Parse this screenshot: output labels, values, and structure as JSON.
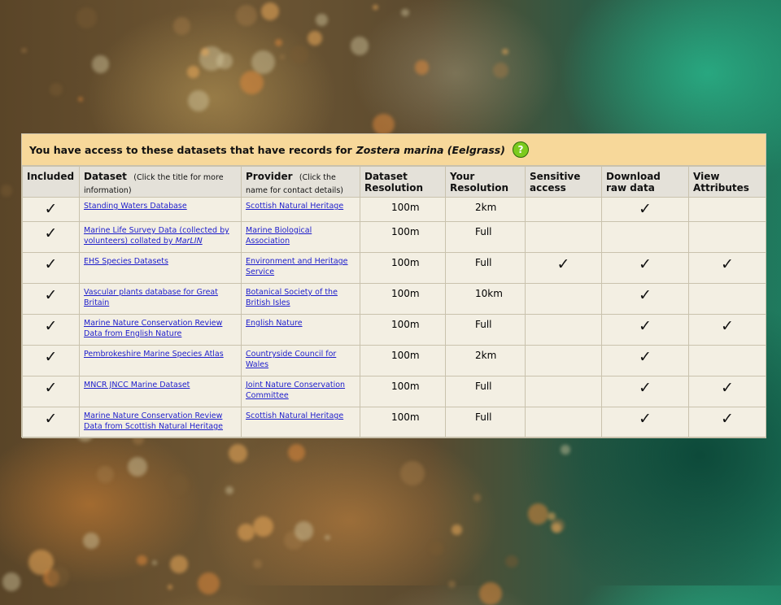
{
  "panel": {
    "header_prefix": "You have access to these datasets that have records for",
    "species": "Zostera marina (Eelgrass)",
    "help_symbol": "?"
  },
  "columns": {
    "included": "Included",
    "dataset": "Dataset",
    "dataset_hint": "(Click the title for more information)",
    "provider": "Provider",
    "provider_hint": "(Click the name for contact details)",
    "dataset_resolution_1": "Dataset",
    "dataset_resolution_2": "Resolution",
    "your_resolution_1": "Your",
    "your_resolution_2": "Resolution",
    "sensitive_1": "Sensitive",
    "sensitive_2": "access",
    "download_1": "Download",
    "download_2": "raw data",
    "view_1": "View",
    "view_2": "Attributes"
  },
  "check_symbol": "✓",
  "rows": [
    {
      "dataset": "Standing Waters Database",
      "dataset_marlin": "",
      "provider": "Scottish Natural Heritage",
      "dataset_resolution": "100m",
      "your_resolution": "2km",
      "included": true,
      "sensitive": false,
      "download": true,
      "view": false
    },
    {
      "dataset": "Marine Life Survey Data (collected by volunteers) collated by ",
      "dataset_marlin": "MarLIN",
      "provider": "Marine Biological Association",
      "dataset_resolution": "100m",
      "your_resolution": "Full",
      "included": true,
      "sensitive": false,
      "download": false,
      "view": false
    },
    {
      "dataset": "EHS Species Datasets",
      "dataset_marlin": "",
      "provider": "Environment and Heritage Service",
      "dataset_resolution": "100m",
      "your_resolution": "Full",
      "included": true,
      "sensitive": true,
      "download": true,
      "view": true
    },
    {
      "dataset": "Vascular plants database for Great Britain",
      "dataset_marlin": "",
      "provider": "Botanical Society of the British Isles",
      "dataset_resolution": "100m",
      "your_resolution": "10km",
      "included": true,
      "sensitive": false,
      "download": true,
      "view": false
    },
    {
      "dataset": "Marine Nature Conservation Review Data from English Nature",
      "dataset_marlin": "",
      "provider": "English Nature",
      "dataset_resolution": "100m",
      "your_resolution": "Full",
      "included": true,
      "sensitive": false,
      "download": true,
      "view": true
    },
    {
      "dataset": "Pembrokeshire Marine Species Atlas",
      "dataset_marlin": "",
      "provider": "Countryside Council for Wales",
      "dataset_resolution": "100m",
      "your_resolution": "2km",
      "included": true,
      "sensitive": false,
      "download": true,
      "view": false
    },
    {
      "dataset": "MNCR JNCC Marine Dataset",
      "dataset_marlin": "",
      "provider": "Joint Nature Conservation Committee",
      "dataset_resolution": "100m",
      "your_resolution": "Full",
      "included": true,
      "sensitive": false,
      "download": true,
      "view": true
    },
    {
      "dataset": "Marine Nature Conservation Review Data from Scottish Natural Heritage",
      "dataset_marlin": "",
      "provider": "Scottish Natural Heritage",
      "dataset_resolution": "100m",
      "your_resolution": "Full",
      "included": true,
      "sensitive": false,
      "download": true,
      "view": true
    }
  ]
}
